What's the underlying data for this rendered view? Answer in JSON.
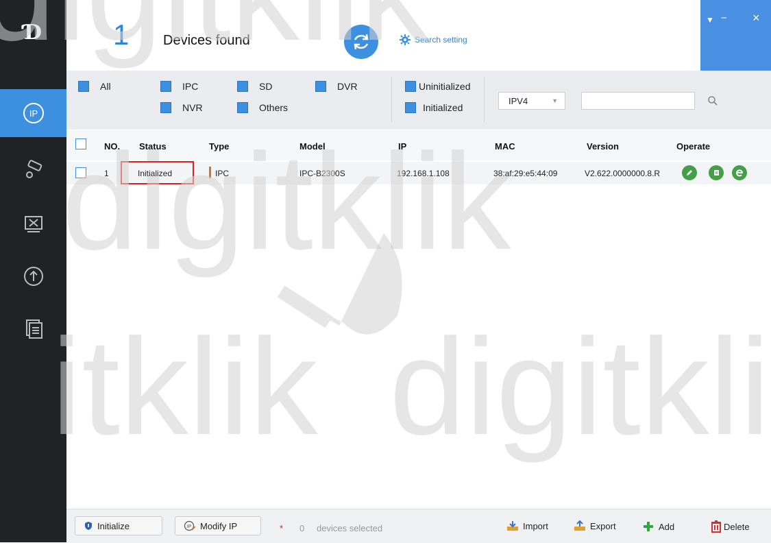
{
  "header": {
    "device_count": "1",
    "devices_found_label": "Devices found",
    "search_setting_label": "Search setting"
  },
  "window": {
    "menu_symbol": "▼",
    "minimize_symbol": "−",
    "close_symbol": "×"
  },
  "filters": {
    "all": "All",
    "ipc": "IPC",
    "sd": "SD",
    "dvr": "DVR",
    "nvr": "NVR",
    "others": "Others",
    "uninitialized": "Uninitialized",
    "initialized": "Initialized",
    "ip_version": "IPV4",
    "search_value": ""
  },
  "table": {
    "columns": [
      "NO.",
      "Status",
      "Type",
      "Model",
      "IP",
      "MAC",
      "Version",
      "Operate"
    ],
    "rows": [
      {
        "no": "1",
        "status": "Initialized",
        "type": "IPC",
        "model": "IPC-B2300S",
        "ip": "192.168.1.108",
        "mac": "38:af:29:e5:44:09",
        "version": "V2.622.0000000.8.R"
      }
    ]
  },
  "bottom": {
    "initialize_label": "Initialize",
    "modify_ip_label": "Modify IP",
    "selected_star": "*",
    "selected_count": "0",
    "selected_label": "devices selected",
    "import_label": "Import",
    "export_label": "Export",
    "add_label": "Add",
    "delete_label": "Delete"
  },
  "watermark": {
    "text_1": "digitklik",
    "text_2": "itklik",
    "text_3": "digitkli"
  },
  "colors": {
    "accent": "#3d8fe0",
    "sidebar": "#1f2326",
    "highlight_box": "#e02020",
    "operate_green": "#43a047"
  }
}
